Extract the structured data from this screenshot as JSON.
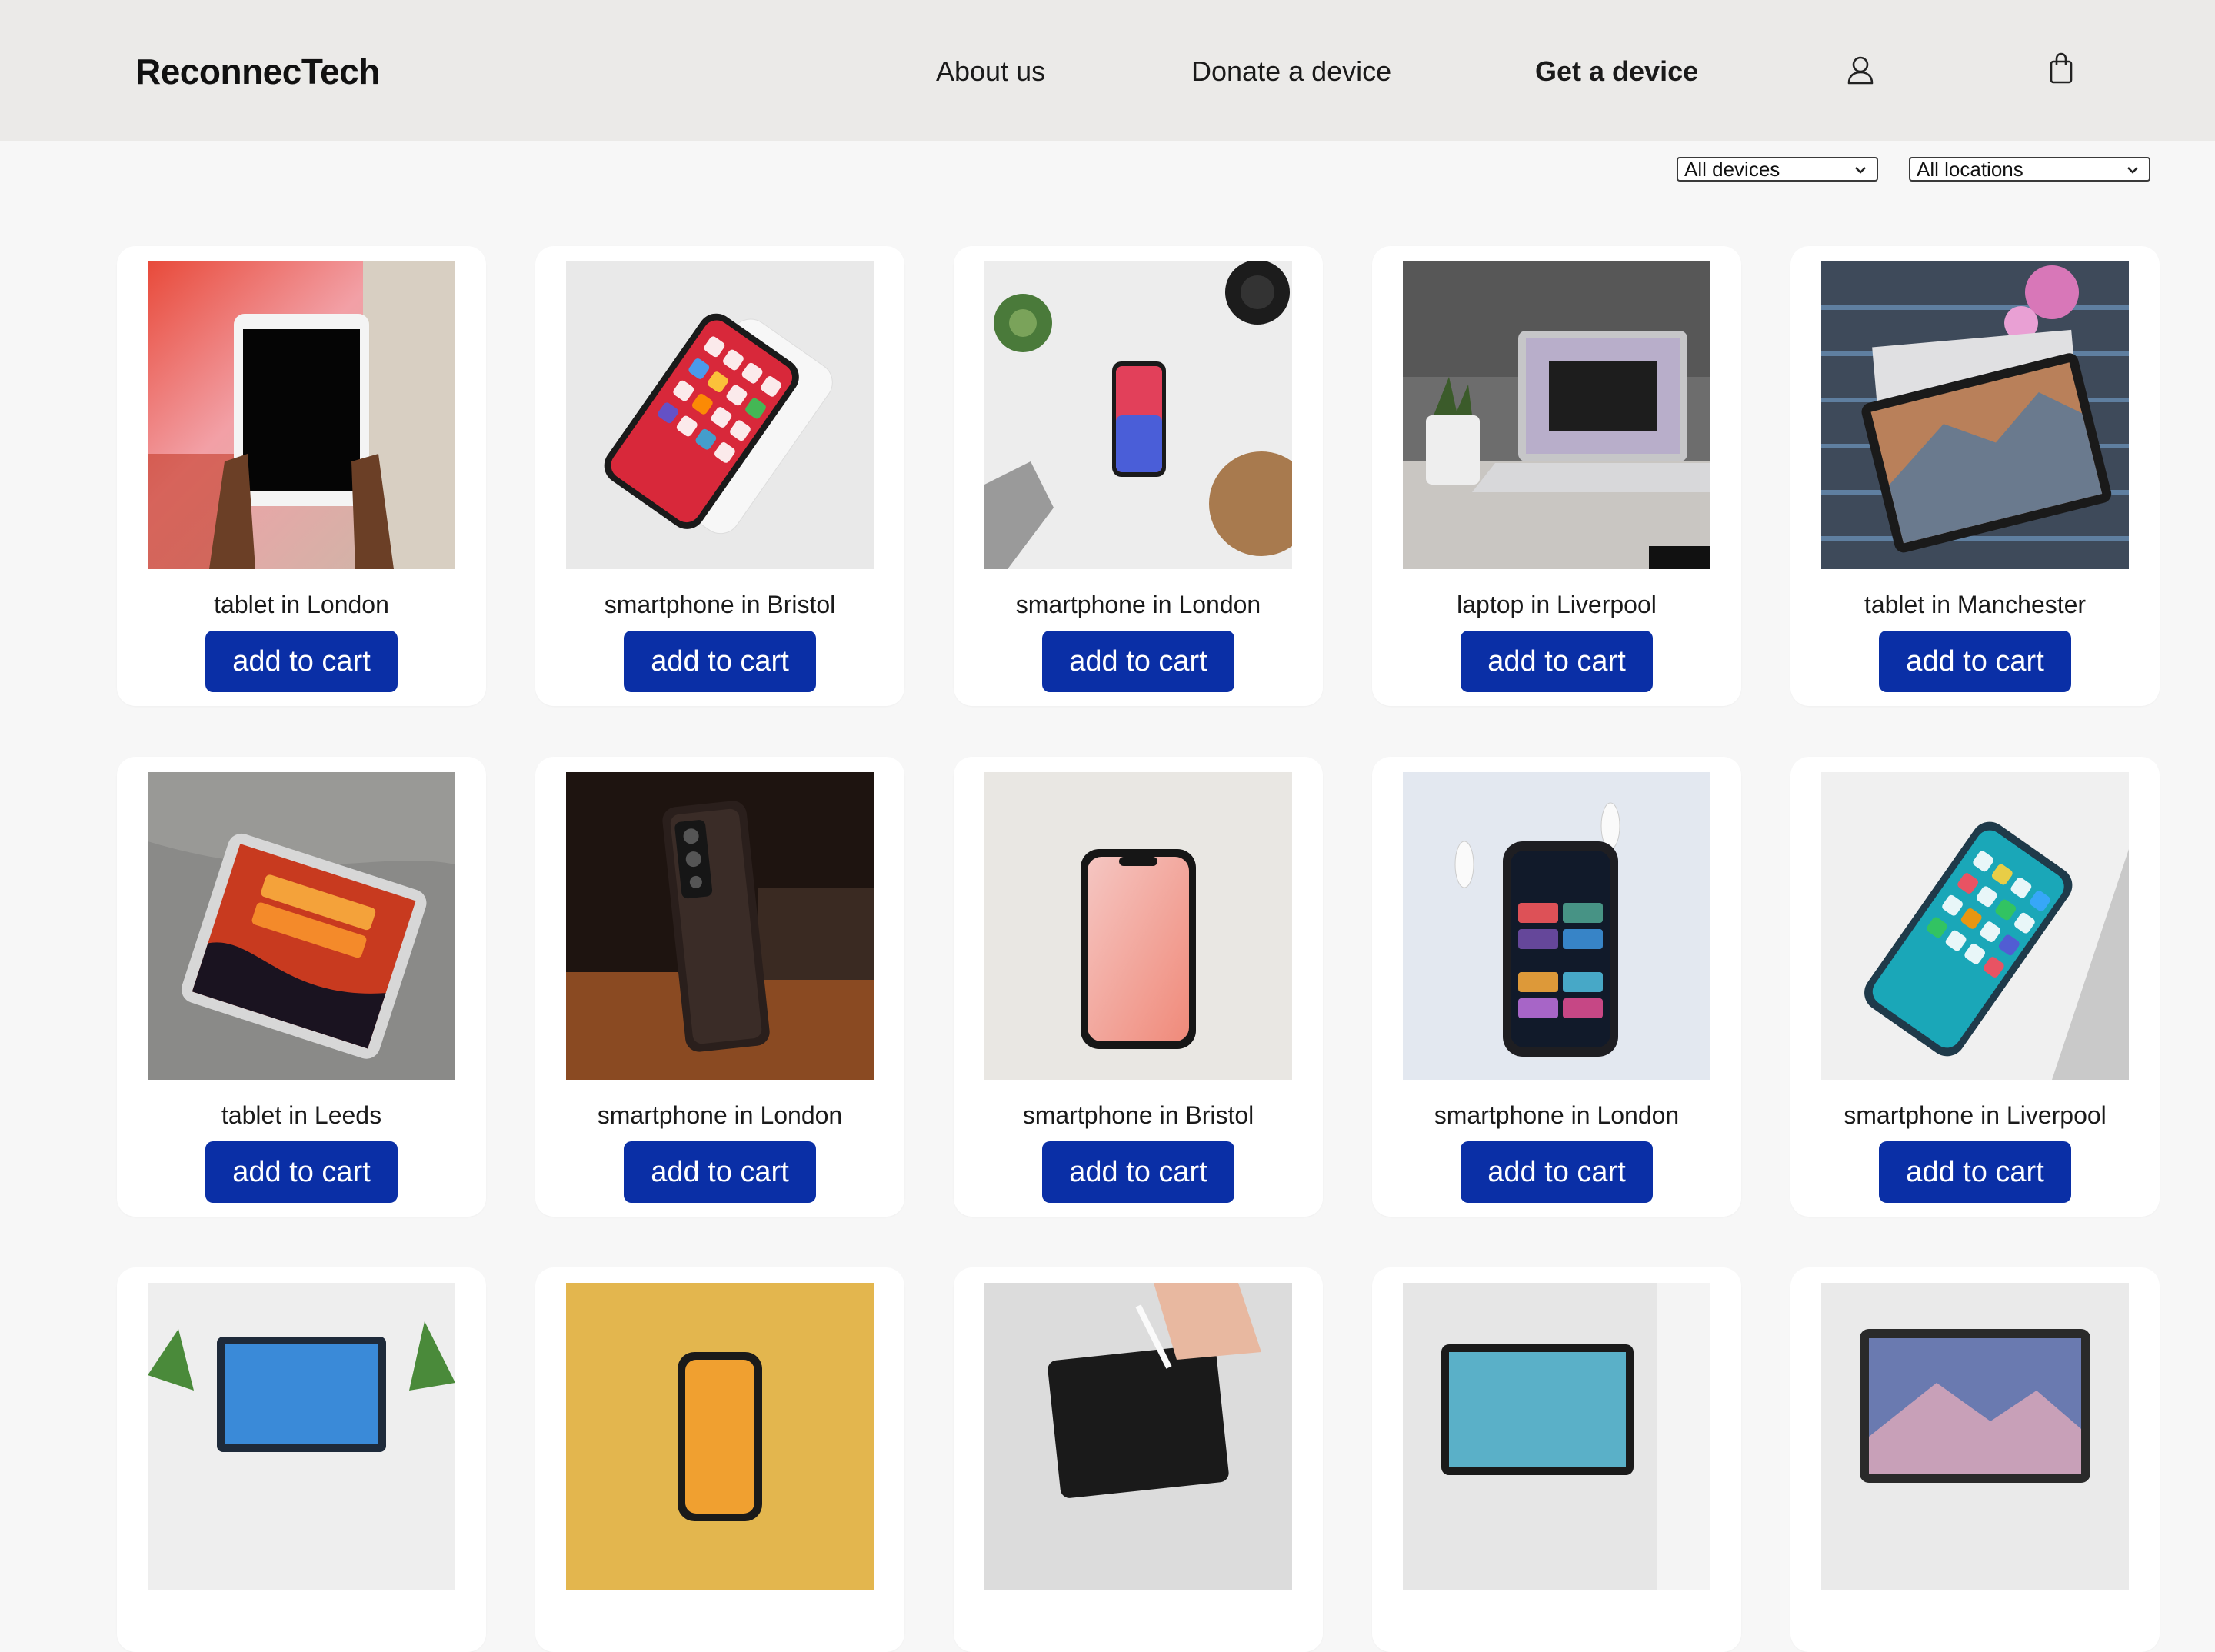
{
  "header": {
    "brand": "ReconnecTech",
    "nav": [
      {
        "label": "About us"
      },
      {
        "label": "Donate a device"
      },
      {
        "label": "Get a device",
        "active": true
      }
    ],
    "icons": [
      "user-icon",
      "shopping-bag-icon"
    ]
  },
  "filters": {
    "device_type": {
      "selected": "All devices"
    },
    "location": {
      "selected": "All locations"
    }
  },
  "products": [
    {
      "caption": "tablet in London",
      "button": "add to cart",
      "photo": "tablet"
    },
    {
      "caption": "smartphone in Bristol",
      "button": "add to cart",
      "photo": "smartphone-red"
    },
    {
      "caption": "smartphone in London",
      "button": "add to cart",
      "photo": "smartphone-white-desk"
    },
    {
      "caption": "laptop in Liverpool",
      "button": "add to cart",
      "photo": "laptop"
    },
    {
      "caption": "tablet in Manchester",
      "button": "add to cart",
      "photo": "tablet-surface"
    },
    {
      "caption": "tablet in Leeds",
      "button": "add to cart",
      "photo": "tablet-bed"
    },
    {
      "caption": "smartphone in London",
      "button": "add to cart",
      "photo": "smartphone-dark"
    },
    {
      "caption": "smartphone in Bristol",
      "button": "add to cart",
      "photo": "smartphone-lockscreen"
    },
    {
      "caption": "smartphone in London",
      "button": "add to cart",
      "photo": "smartphone-music"
    },
    {
      "caption": "smartphone in Liverpool",
      "button": "add to cart",
      "photo": "smartphone-teal"
    },
    {
      "caption": "",
      "button": "",
      "photo": "laptop-plants"
    },
    {
      "caption": "",
      "button": "",
      "photo": "smartphone-yellow"
    },
    {
      "caption": "",
      "button": "",
      "photo": "tablet-pen"
    },
    {
      "caption": "",
      "button": "",
      "photo": "laptop-teal"
    },
    {
      "caption": "",
      "button": "",
      "photo": "laptop-mountain"
    }
  ],
  "colors": {
    "header_bg": "#ebeae8",
    "page_bg": "#f7f7f7",
    "button_bg": "#0a2fa6",
    "button_text": "#ffffff"
  }
}
